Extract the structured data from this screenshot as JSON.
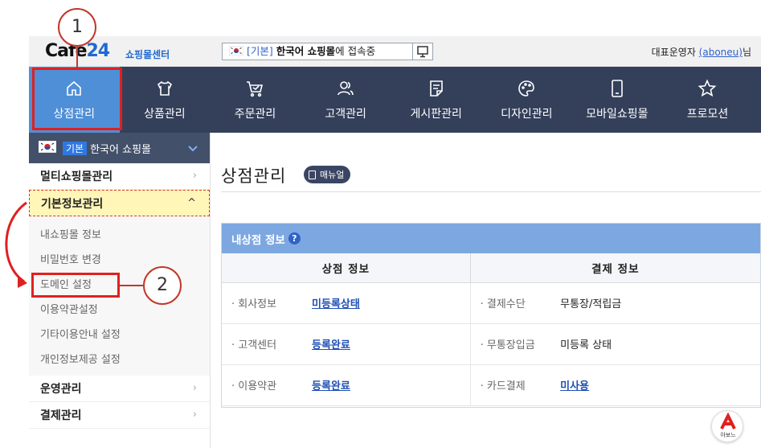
{
  "header": {
    "logo_word": "Cafe",
    "logo_num": "24",
    "logo_sub": "쇼핑몰센터",
    "mall_kind": "[기본]",
    "mall_name": "한국어 쇼핑몰",
    "mall_suffix": "에 접속중",
    "admin_label": "대표운영자",
    "admin_id": "(aboneu)",
    "admin_suffix": "님"
  },
  "nav": [
    {
      "label": "상점관리",
      "icon": "home-icon"
    },
    {
      "label": "상품관리",
      "icon": "shirt-icon"
    },
    {
      "label": "주문관리",
      "icon": "cart-icon"
    },
    {
      "label": "고객관리",
      "icon": "people-icon"
    },
    {
      "label": "게시판관리",
      "icon": "board-icon"
    },
    {
      "label": "디자인관리",
      "icon": "palette-icon"
    },
    {
      "label": "모바일쇼핑몰",
      "icon": "mobile-icon"
    },
    {
      "label": "프로모션",
      "icon": "star-icon"
    }
  ],
  "sidebar": {
    "mall_tag": "기본",
    "mall_name": "한국어 쇼핑몰",
    "groups": [
      {
        "label": "멀티쇼핑몰관리"
      },
      {
        "label": "기본정보관리"
      },
      {
        "label": "운영관리"
      },
      {
        "label": "결제관리"
      }
    ],
    "sub_items": [
      {
        "label": "내쇼핑몰 정보"
      },
      {
        "label": "비밀번호 변경"
      },
      {
        "label": "도메인 설정"
      },
      {
        "label": "이용약관설정"
      },
      {
        "label": "기타이용안내 설정"
      },
      {
        "label": "개인정보제공 설정"
      }
    ]
  },
  "main": {
    "title": "상점관리",
    "manual_label": "매뉴얼",
    "panel_title": "내상점 정보",
    "help_glyph": "?",
    "col_store": "상점 정보",
    "col_payment": "결제 정보",
    "rows": [
      {
        "store_label": "· 회사정보",
        "store_value": "미등록상태",
        "pay_label": "· 결제수단",
        "pay_value": "무통장/적립금"
      },
      {
        "store_label": "· 고객센터",
        "store_value": "등록완료",
        "pay_label": "· 무통장입금",
        "pay_value": "미등록 상태"
      },
      {
        "store_label": "· 이용약관",
        "store_value": "등록완료",
        "pay_label": "· 카드결제",
        "pay_value": "미사용"
      }
    ]
  },
  "annotations": {
    "step1": "1",
    "step2": "2",
    "brand_text": "아보느"
  },
  "colors": {
    "nav_bg": "#34405a",
    "nav_active": "#4f8fd7",
    "panel_head": "#7da7e0",
    "annotation": "#e02020",
    "link": "#1f4fb5"
  }
}
